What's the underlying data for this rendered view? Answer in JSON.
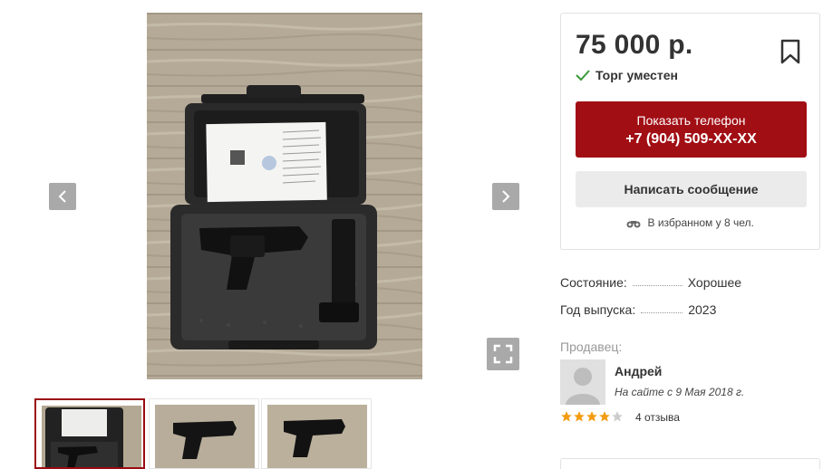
{
  "listing": {
    "price": "75 000 р.",
    "bargain_text": "Торг уместен",
    "phone_button": {
      "label": "Показать телефон",
      "number": "+7 (904) 509-XX-XX"
    },
    "message_button_label": "Написать сообщение",
    "favorites_text": "В избранном у 8 чел."
  },
  "specs": [
    {
      "key": "Состояние:",
      "value": "Хорошее"
    },
    {
      "key": "Год выпуска:",
      "value": "2023"
    }
  ],
  "seller": {
    "label": "Продавец:",
    "name": "Андрей",
    "since": "На сайте с 9 Мая 2018 г.",
    "rating": 4,
    "rating_max": 5,
    "reviews_text": "4 отзыва"
  },
  "gallery": {
    "thumbnail_count": 3,
    "active_thumbnail": 1
  },
  "colors": {
    "accent": "#a10e14",
    "star_filled": "#f39c12",
    "star_empty": "#cccccc",
    "check": "#3a9a3a"
  },
  "icons": {
    "prev": "chevron-left-icon",
    "next": "chevron-right-icon",
    "fullscreen": "fullscreen-icon",
    "bookmark": "bookmark-icon",
    "check": "check-icon",
    "favorites": "binoculars-icon"
  }
}
